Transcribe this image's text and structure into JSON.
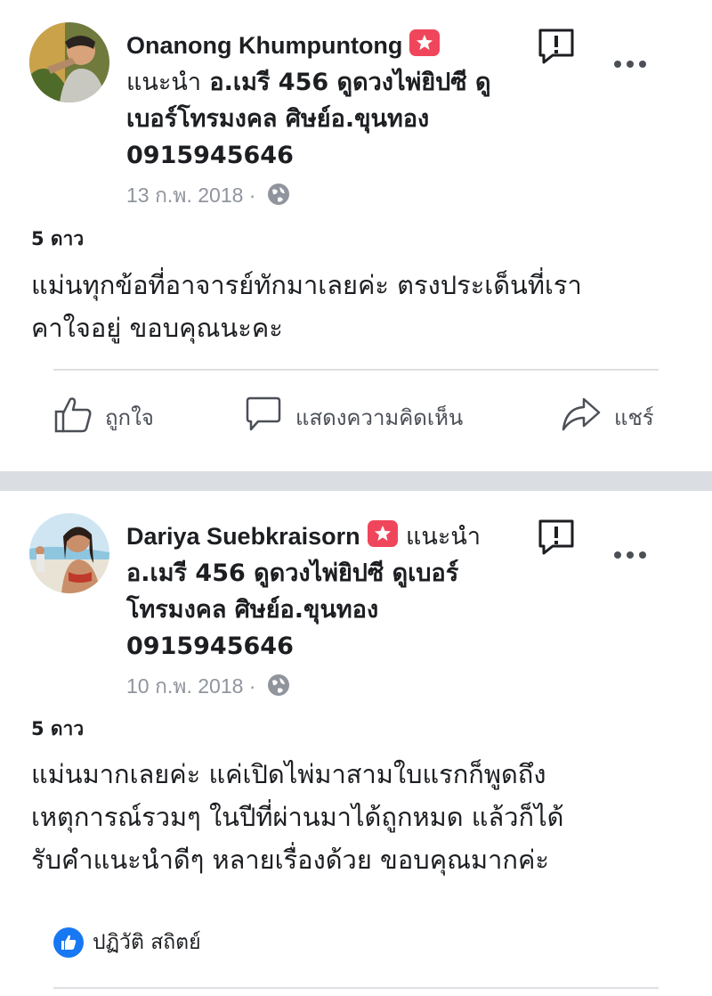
{
  "posts": [
    {
      "author": "Onanong Khumpuntong",
      "rec_prefix": "แนะนำ",
      "rec_lines": [
        "อ.เมรี 456 ดูดวงไพ่ยิปซี ดู",
        "เบอร์โทรมงคล ศิษย์อ.ขุนทอง",
        "0915945646"
      ],
      "rec_first_suffix": "",
      "date": "13 ก.พ. 2018 ·",
      "rating": "5 ดาว",
      "body": [
        "แม่นทุกข้อที่อาจารย์ทักมาเลยค่ะ ตรงประเด็นที่เรา",
        "คาใจอยู่ ขอบคุณนะคะ"
      ]
    },
    {
      "author": "Dariya Suebkraisorn",
      "rec_prefix": "แนะนำ",
      "rec_lines": [
        "อ.เมรี 456 ดูดวงไพ่ยิปซี ดูเบอร์",
        "โทรมงคล ศิษย์อ.ขุนทอง",
        "0915945646"
      ],
      "date": "10 ก.พ. 2018 ·",
      "rating": "5 ดาว",
      "body": [
        "แม่นมากเลยค่ะ แค่เปิดไพ่มาสามใบแรกก็พูดถึง",
        "เหตุการณ์รวมๆ ในปีที่ผ่านมาได้ถูกหมด แล้วก็ได้",
        "รับคำแนะนำดีๆ หลายเรื่องด้วย ขอบคุณมากค่ะ"
      ]
    }
  ],
  "actions": {
    "like": "ถูกใจ",
    "comment": "แสดงความคิดเห็น",
    "share": "แชร์"
  },
  "responder": {
    "name": "ปฏิวัติ สถิตย์",
    "icon": "thumbs-up-icon"
  },
  "colors": {
    "badge": "#f0465b",
    "meta": "#90949c",
    "like_blue": "#1877f2",
    "band": "#dadde1"
  }
}
